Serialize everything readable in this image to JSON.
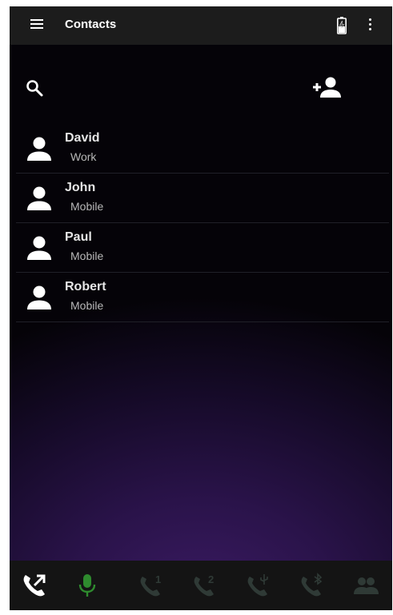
{
  "toolbar": {
    "title": "Contacts",
    "menu_icon": "hamburger-menu-icon",
    "battery_icon": "battery-charging-icon",
    "more_icon": "more-vertical-icon"
  },
  "actions": {
    "search_icon": "search-icon",
    "add_contact_icon": "add-person-icon"
  },
  "contacts": [
    {
      "name": "David",
      "type": "Work"
    },
    {
      "name": "John",
      "type": "Mobile"
    },
    {
      "name": "Paul",
      "type": "Mobile"
    },
    {
      "name": "Robert",
      "type": "Mobile"
    }
  ],
  "bottom_bar": {
    "items": [
      {
        "icon": "call-transfer-icon",
        "state": "active"
      },
      {
        "icon": "microphone-icon",
        "state": "active"
      },
      {
        "icon": "call-line-1-icon",
        "state": "disabled",
        "label": "1"
      },
      {
        "icon": "call-line-2-icon",
        "state": "disabled",
        "label": "2"
      },
      {
        "icon": "call-usb-icon",
        "state": "disabled"
      },
      {
        "icon": "call-bluetooth-icon",
        "state": "disabled"
      },
      {
        "icon": "group-icon",
        "state": "disabled"
      }
    ]
  },
  "colors": {
    "toolbar_bg": "#1c1c1c",
    "mic_active": "#2e8b2e",
    "disabled_icon": "#2f3a36",
    "accent_bg": "#3b1b63"
  }
}
